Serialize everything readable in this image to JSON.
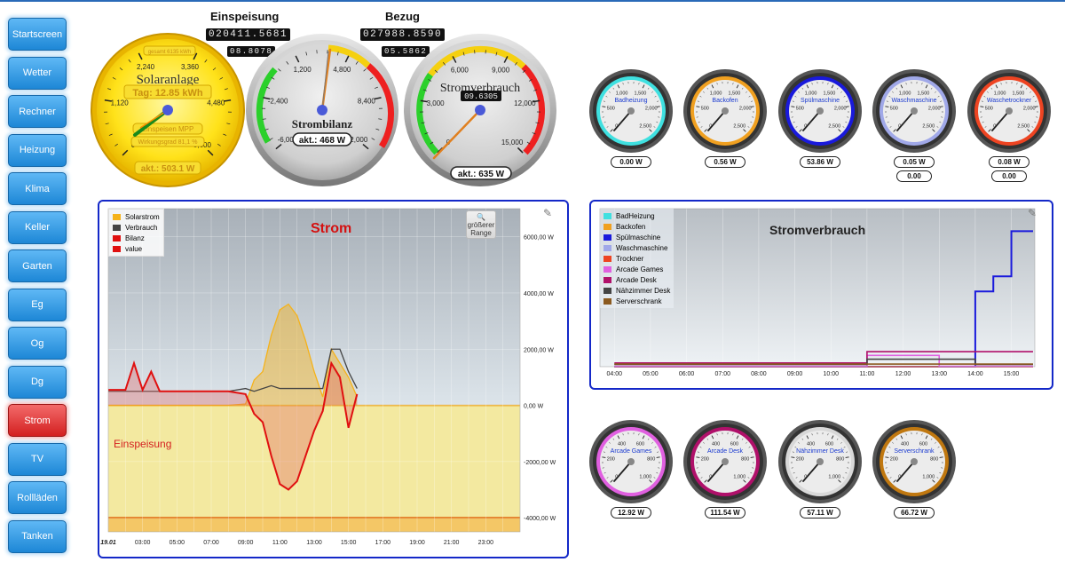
{
  "sidebar": {
    "items": [
      {
        "label": "Startscreen",
        "active": false
      },
      {
        "label": "Wetter",
        "active": false
      },
      {
        "label": "Rechner",
        "active": false
      },
      {
        "label": "Heizung",
        "active": false
      },
      {
        "label": "Klima",
        "active": false
      },
      {
        "label": "Keller",
        "active": false
      },
      {
        "label": "Garten",
        "active": false
      },
      {
        "label": "Eg",
        "active": false
      },
      {
        "label": "Og",
        "active": false
      },
      {
        "label": "Dg",
        "active": false
      },
      {
        "label": "Strom",
        "active": true
      },
      {
        "label": "TV",
        "active": false
      },
      {
        "label": "Rollläden",
        "active": false
      },
      {
        "label": "Tanken",
        "active": false
      }
    ]
  },
  "header": {
    "einspeisung_label": "Einspeisung",
    "einspeisung_counter": "020411.5681",
    "einspeisung_sub": "08.8078",
    "bezug_label": "Bezug",
    "bezug_counter": "027988.8590",
    "bezug_sub": "05.5862"
  },
  "solar_gauge": {
    "title": "Solaranlage",
    "tag": "Tag: 12.85 kWh",
    "gesamt": "gesamt 6135 kWh",
    "mpp": "Einspeisen MPP",
    "wirkungsgrad": "Wirkungsgrad 81,1 %",
    "akt": "akt.: 503.1 W",
    "ticks": [
      "0",
      "1,120",
      "2,240",
      "3,360",
      "4,480",
      "5,600"
    ]
  },
  "bilanz_gauge": {
    "title": "Strombilanz",
    "akt": "akt.: 468 W",
    "ticks": [
      "-6,000",
      "-2,400",
      "1,200",
      "4,800",
      "8,400",
      "12,000"
    ]
  },
  "verbrauch_gauge": {
    "title": "Stromverbrauch",
    "counter": "09.6305",
    "akt": "akt.: 635 W",
    "ticks": [
      "0",
      "3,000",
      "6,000",
      "9,000",
      "12,000",
      "15,000"
    ]
  },
  "small_gauges_top": [
    {
      "label": "Badheizung",
      "value": "0.00 W",
      "extra": "",
      "color": "#3fe0e0"
    },
    {
      "label": "Backofen",
      "value": "0.56 W",
      "extra": "",
      "color": "#f0a020"
    },
    {
      "label": "Spülmaschine",
      "value": "53.86 W",
      "extra": "",
      "color": "#1a1adc"
    },
    {
      "label": "Waschmaschine",
      "value": "0.05 W",
      "extra": "0.00",
      "color": "#a0a8e8"
    },
    {
      "label": "Waschetrockner",
      "value": "0.08 W",
      "extra": "0.00",
      "color": "#ee4422"
    }
  ],
  "small_gauges_top_ticks": [
    "0",
    "500",
    "1,000",
    "1,500",
    "2,000",
    "2,500"
  ],
  "small_gauges_bottom": [
    {
      "label": "Arcade Games",
      "value": "12.92 W",
      "color": "#e060e0"
    },
    {
      "label": "Arcade Desk",
      "value": "111.54 W",
      "color": "#b0106a"
    },
    {
      "label": "Nähzimmer Desk",
      "value": "57.11 W",
      "color": "#d8d8d8"
    },
    {
      "label": "Serverschrank",
      "value": "66.72 W",
      "color": "#c07810"
    }
  ],
  "small_gauges_bottom_ticks": [
    "0",
    "200",
    "400",
    "600",
    "800",
    "1,000"
  ],
  "strom_chart": {
    "title": "Strom",
    "annotation": "Einspeisung",
    "range_button": "größerer Range",
    "legend": [
      {
        "name": "Solarstrom",
        "color": "#f5b21a"
      },
      {
        "name": "Verbrauch",
        "color": "#444444"
      },
      {
        "name": "Bilanz",
        "color": "#e01010"
      },
      {
        "name": "value",
        "color": "#e01010"
      }
    ],
    "x_ticks": [
      "19.01",
      "03:00",
      "05:00",
      "07:00",
      "09:00",
      "11:00",
      "13:00",
      "15:00",
      "17:00",
      "19:00",
      "21:00",
      "23:00"
    ],
    "y_ticks": [
      "6000,00 W",
      "4000,00 W",
      "2000,00 W",
      "0,00 W",
      "-2000,00 W",
      "-4000,00 W"
    ]
  },
  "chart_data": [
    {
      "type": "line",
      "title": "Strom",
      "xlabel": "",
      "ylabel": "",
      "ylim": [
        -4500,
        7000
      ],
      "x": [
        "01:00",
        "02:00",
        "02:30",
        "03:00",
        "03:30",
        "04:00",
        "05:00",
        "06:00",
        "07:00",
        "08:00",
        "09:00",
        "09:30",
        "10:00",
        "10:30",
        "11:00",
        "11:30",
        "12:00",
        "12:30",
        "13:00",
        "13:30",
        "14:00",
        "14:30",
        "15:00",
        "15:30"
      ],
      "series": [
        {
          "name": "Solarstrom",
          "values": [
            0,
            0,
            0,
            0,
            0,
            0,
            0,
            0,
            0,
            0,
            50,
            900,
            1200,
            2500,
            3400,
            3600,
            3200,
            2300,
            1200,
            300,
            2000,
            1500,
            1000,
            300
          ]
        },
        {
          "name": "Verbrauch",
          "values": [
            500,
            500,
            500,
            500,
            500,
            500,
            500,
            500,
            500,
            500,
            600,
            500,
            600,
            700,
            600,
            600,
            600,
            600,
            600,
            600,
            2000,
            2000,
            1200,
            600
          ]
        },
        {
          "name": "Bilanz",
          "values": [
            550,
            550,
            1500,
            550,
            1200,
            500,
            500,
            500,
            500,
            500,
            400,
            -300,
            -600,
            -1800,
            -2800,
            -3000,
            -2700,
            -1800,
            -900,
            -200,
            1500,
            1000,
            -800,
            400
          ]
        }
      ]
    },
    {
      "type": "line",
      "title": "Stromverbrauch",
      "xlabel": "",
      "ylabel": "",
      "x": [
        "04:00",
        "05:00",
        "06:00",
        "07:00",
        "08:00",
        "09:00",
        "10:00",
        "11:00",
        "12:00",
        "13:00",
        "14:00",
        "14:30",
        "15:00"
      ],
      "series": [
        {
          "name": "BadHeizung",
          "values": [
            0,
            0,
            0,
            0,
            0,
            0,
            0,
            0,
            0,
            0,
            0,
            0,
            0
          ]
        },
        {
          "name": "Backofen",
          "values": [
            0,
            0,
            0,
            0,
            0,
            0,
            0,
            0,
            0,
            0,
            0,
            0,
            0
          ]
        },
        {
          "name": "Spülmaschine",
          "values": [
            0,
            0,
            0,
            0,
            0,
            0,
            0,
            0,
            0,
            0,
            2000,
            2400,
            3600
          ]
        },
        {
          "name": "Waschmaschine",
          "values": [
            0,
            0,
            0,
            0,
            0,
            0,
            0,
            0,
            0,
            0,
            0,
            0,
            0
          ]
        },
        {
          "name": "Trockner",
          "values": [
            0,
            0,
            0,
            0,
            0,
            0,
            0,
            0,
            0,
            0,
            0,
            0,
            0
          ]
        },
        {
          "name": "Arcade Games",
          "values": [
            10,
            10,
            10,
            10,
            10,
            10,
            10,
            300,
            300,
            10,
            10,
            10,
            10
          ]
        },
        {
          "name": "Arcade Desk",
          "values": [
            100,
            100,
            100,
            100,
            100,
            100,
            100,
            400,
            400,
            400,
            400,
            400,
            400
          ]
        },
        {
          "name": "Nähzimmer Desk",
          "values": [
            60,
            60,
            60,
            60,
            60,
            60,
            60,
            200,
            200,
            200,
            60,
            60,
            60
          ]
        },
        {
          "name": "Serverschrank",
          "values": [
            70,
            70,
            70,
            70,
            70,
            70,
            70,
            70,
            70,
            70,
            70,
            70,
            70
          ]
        }
      ]
    }
  ],
  "verbrauch_chart": {
    "title": "Stromverbrauch",
    "legend": [
      {
        "name": "BadHeizung",
        "color": "#3fe0e0"
      },
      {
        "name": "Backofen",
        "color": "#f0a020"
      },
      {
        "name": "Spülmaschine",
        "color": "#1a1adc"
      },
      {
        "name": "Waschmaschine",
        "color": "#a0a8e8"
      },
      {
        "name": "Trockner",
        "color": "#ee4422"
      },
      {
        "name": "Arcade Games",
        "color": "#e060e0"
      },
      {
        "name": "Arcade Desk",
        "color": "#b0106a"
      },
      {
        "name": "Nähzimmer Desk",
        "color": "#444444"
      },
      {
        "name": "Serverschrank",
        "color": "#8b5a20"
      }
    ],
    "x_ticks": [
      "04:00",
      "05:00",
      "06:00",
      "07:00",
      "08:00",
      "09:00",
      "10:00",
      "11:00",
      "12:00",
      "13:00",
      "14:00",
      "15:00"
    ]
  }
}
